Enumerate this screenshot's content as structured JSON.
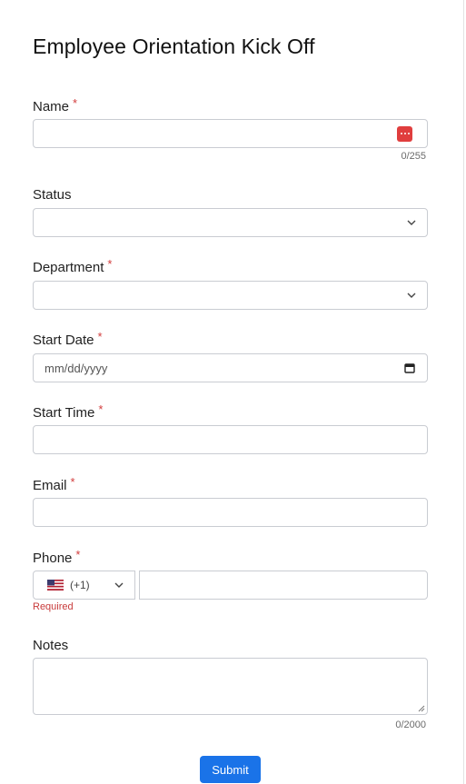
{
  "form": {
    "title": "Employee Orientation Kick Off",
    "required_mark": "*",
    "fields": {
      "name": {
        "label": "Name",
        "counter": "0/255"
      },
      "status": {
        "label": "Status"
      },
      "department": {
        "label": "Department"
      },
      "start_date": {
        "label": "Start Date",
        "placeholder": "mm/dd/yyyy"
      },
      "start_time": {
        "label": "Start Time"
      },
      "email": {
        "label": "Email"
      },
      "phone": {
        "label": "Phone",
        "country_code": "(+1)",
        "error": "Required"
      },
      "notes": {
        "label": "Notes",
        "counter": "0/2000"
      }
    },
    "submit_label": "Submit"
  },
  "colors": {
    "accent": "#1a73e8",
    "required": "#d23c3c",
    "border": "#c9ccd2"
  },
  "icons": {
    "password_manager": "password-manager-icon",
    "dropdown": "chevron-down-icon",
    "calendar": "calendar-icon",
    "flag": "us-flag-icon"
  }
}
